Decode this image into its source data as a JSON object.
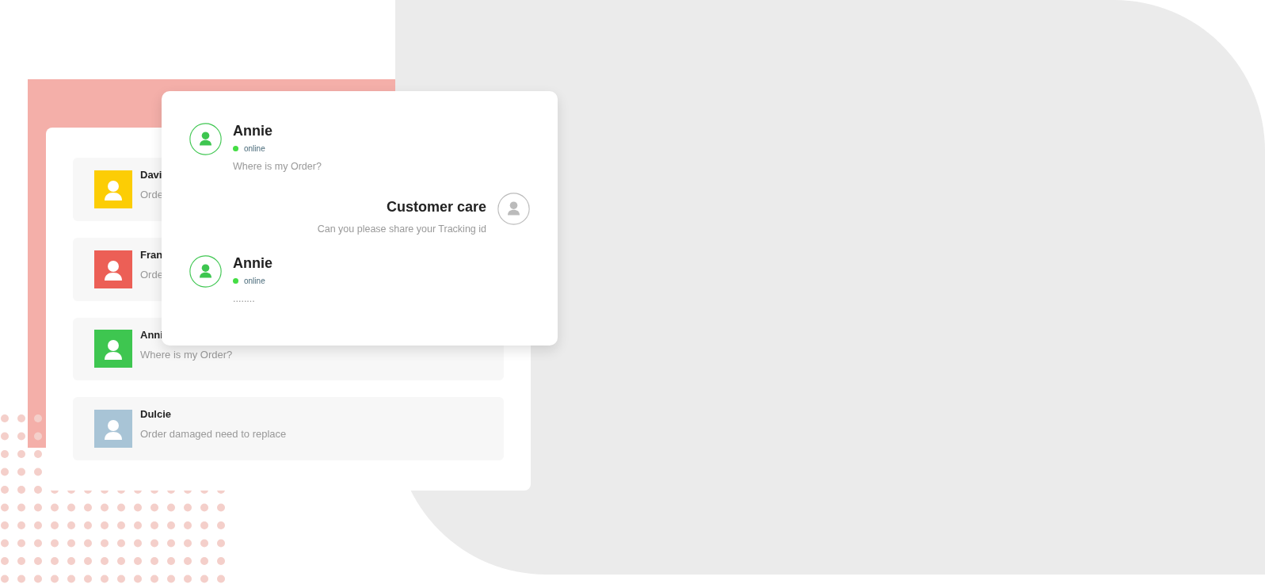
{
  "contacts": [
    {
      "name": "Davi",
      "preview": "Orde",
      "color": "#fccd05"
    },
    {
      "name": "Fran",
      "preview": "Orde",
      "color": "#ec5f56"
    },
    {
      "name": "Anni",
      "preview": "Where is my Order?",
      "color": "#3ec650"
    },
    {
      "name": "Dulcie",
      "preview": "Order damaged need to replace",
      "color": "#a8c4d6"
    }
  ],
  "chat": [
    {
      "kind": "incoming",
      "sender": "Annie",
      "status": {
        "label": "online",
        "color": "#44dd44"
      },
      "text": "Where is my Order?"
    },
    {
      "kind": "outgoing",
      "sender": "Customer care",
      "text": "Can you please share your Tracking id"
    },
    {
      "kind": "incoming",
      "sender": "Annie",
      "status": {
        "label": "online",
        "color": "#44dd44"
      },
      "text": "........"
    }
  ]
}
